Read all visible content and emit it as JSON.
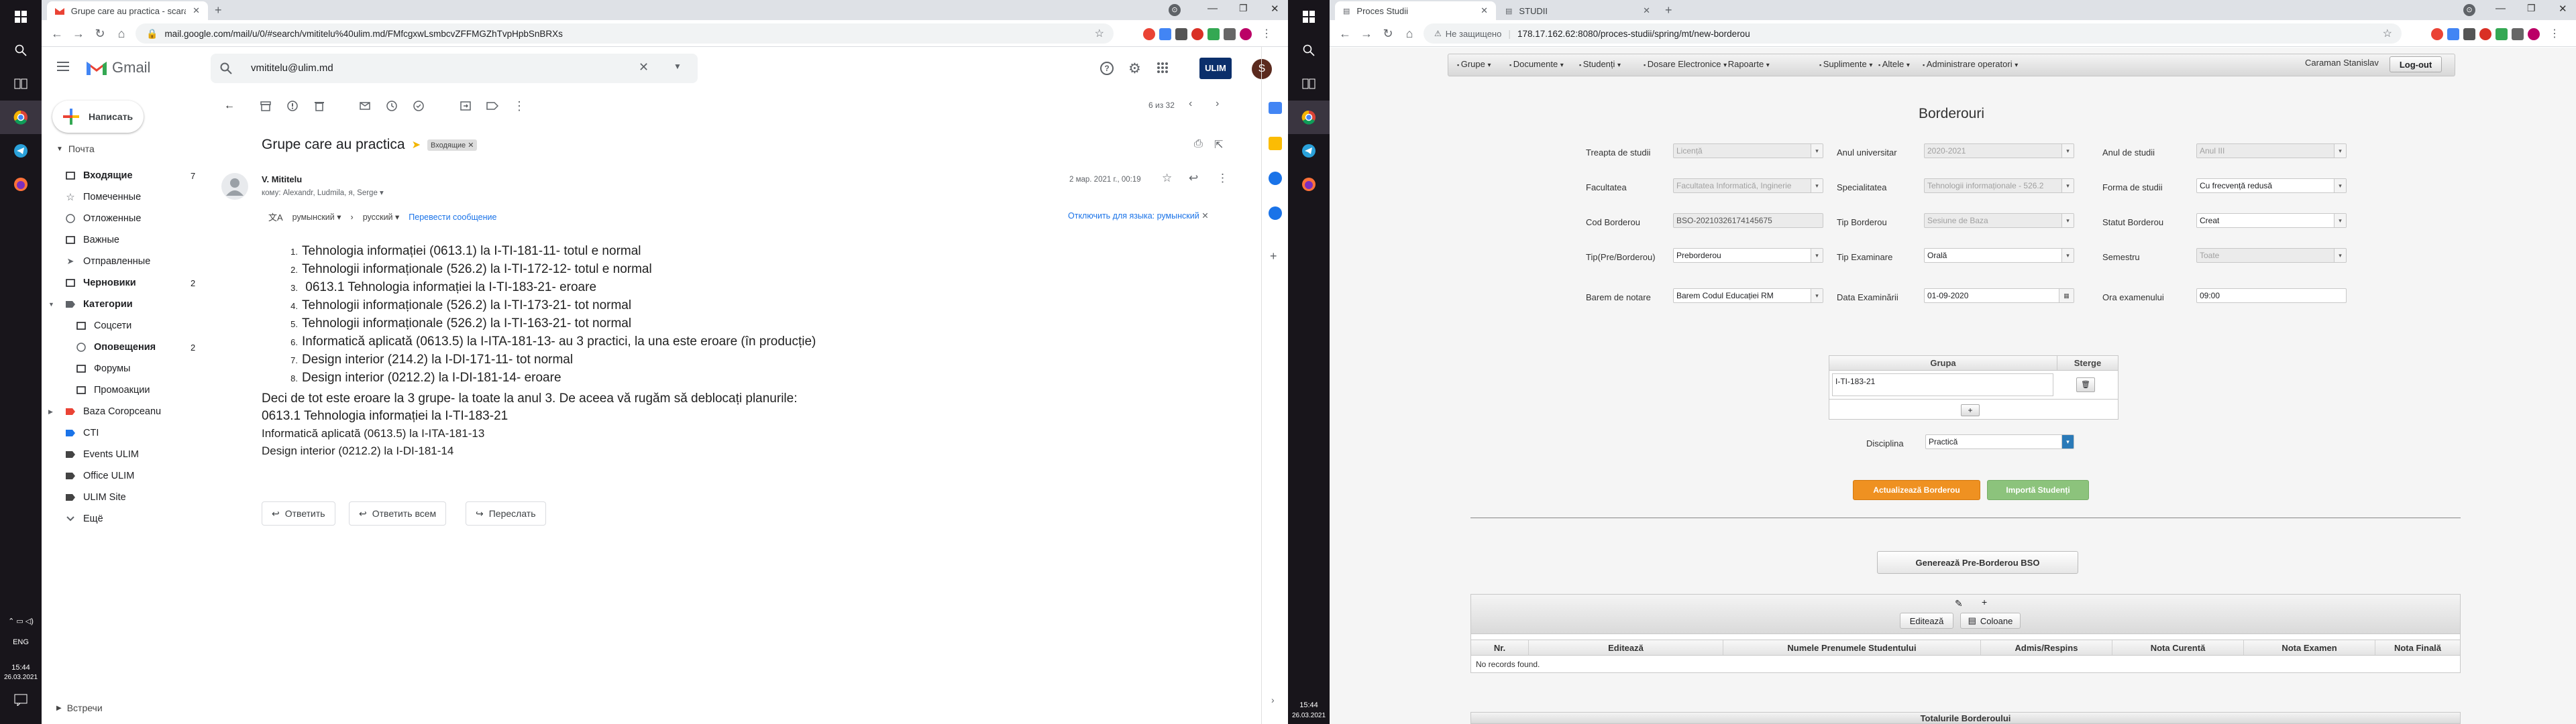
{
  "taskbar_left": {
    "time": "15:44",
    "date": "26.03.2021",
    "lang": "ENG"
  },
  "taskbar_right": {
    "time": "15:44",
    "date": "26.03.2021"
  },
  "win1": {
    "tab_title": "Grupe care au practica - scaram",
    "url": "mail.google.com/mail/u/0/#search/vmititelu%40ulim.md/FMfcgxwLsmbcvZFFMGZhTvpHpbSnBRXs",
    "product": "Gmail",
    "search": "vmititelu@ulim.md",
    "compose": "Написать",
    "avatar": "S",
    "brand_logo": "ULIM",
    "mail_section": "Почта",
    "folders": [
      {
        "label": "Входящие",
        "count": "7",
        "bold": true
      },
      {
        "label": "Помеченные",
        "count": ""
      },
      {
        "label": "Отложенные",
        "count": ""
      },
      {
        "label": "Важные",
        "count": ""
      },
      {
        "label": "Отправленные",
        "count": ""
      },
      {
        "label": "Черновики",
        "count": "2",
        "bold": true
      },
      {
        "label": "Категории",
        "count": "",
        "bold": true
      },
      {
        "label": "Соцсети",
        "count": ""
      },
      {
        "label": "Оповещения",
        "count": "2",
        "bold": true
      },
      {
        "label": "Форумы",
        "count": ""
      },
      {
        "label": "Промоакции",
        "count": ""
      },
      {
        "label": "Baza Coropceanu",
        "count": ""
      },
      {
        "label": "CTI",
        "count": ""
      },
      {
        "label": "Events ULIM",
        "count": ""
      },
      {
        "label": "Office ULIM",
        "count": ""
      },
      {
        "label": "ULIM Site",
        "count": ""
      },
      {
        "label": "Ещё",
        "count": ""
      }
    ],
    "meet": "Встречи",
    "pager": "6 из 32",
    "subject": "Grupe care au practica",
    "label_chip": "Входящие",
    "sender": "V. Mititelu",
    "recipients": "кому: Alexandr, Ludmila, я, Serge",
    "date": "2 мар. 2021 г., 00:19",
    "translate": {
      "from": "румынский",
      "to": "русский",
      "action": "Перевести сообщение",
      "disable": "Отключить для языка: румынский"
    },
    "list": [
      "Tehnologia informației (0613.1) la I-TI-181-11- totul e normal",
      "Tehnologii informaționale (526.2) la I-TI-172-12- totul e normal",
      " 0613.1 Tehnologia informației la I-TI-183-21- eroare",
      "Tehnologii informaționale (526.2) la I-TI-173-21- tot normal",
      "Tehnologii informaționale (526.2) la I-TI-163-21- tot normal",
      "Informatică aplicată (0613.5) la I-ITA-181-13- au 3 practici, la una este eroare (în producție)",
      "Design interior (214.2) la I-DI-171-11- tot normal",
      "Design interior (0212.2) la I-DI-181-14- eroare"
    ],
    "para1": "Deci de tot este eroare la 3 grupe- la toate la anul 3. De aceea vă rugăm să deblocați planurile:",
    "para2": "0613.1 Tehnologia informației la I-TI-183-21",
    "para3": "Informatică aplicată (0613.5) la I-ITA-181-13",
    "para4": "Design interior (0212.2) la I-DI-181-14",
    "reply": "Ответить",
    "reply_all": "Ответить всем",
    "forward": "Переслать"
  },
  "win2": {
    "tab1": "Proces Studii",
    "tab2": "STUDII",
    "insecure": "Не защищено",
    "url": "178.17.162.62:8080/proces-studii/spring/mt/new-borderou",
    "menu": [
      "Grupe",
      "Documente",
      "Studenți",
      "Dosare Electronice",
      "Rapoarte",
      "Suplimente",
      "Altele",
      "Administrare operatori"
    ],
    "user": "Caraman Stanislav",
    "logout": "Log-out",
    "heading": "Borderouri",
    "f": {
      "treapta_l": "Treapta de studii",
      "treapta_v": "Licență",
      "anuniv_l": "Anul universitar",
      "anuniv_v": "2020-2021",
      "anstud_l": "Anul de studii",
      "anstud_v": "Anul III",
      "fac_l": "Facultatea",
      "fac_v": "Facultatea Informatică, Inginerie",
      "spec_l": "Specialitatea",
      "spec_v": "Tehnologii informaționale - 526.2",
      "forma_l": "Forma de studii",
      "forma_v": "Cu frecvență redusă",
      "cod_l": "Cod Borderou",
      "cod_v": "BSO-20210326174145675",
      "tipb_l": "Tip Borderou",
      "tipb_v": "Sesiune de Baza",
      "statut_l": "Statut Borderou",
      "statut_v": "Creat",
      "tippre_l": "Tip(Pre/Borderou)",
      "tippre_v": "Preborderou",
      "tipex_l": "Tip Examinare",
      "tipex_v": "Orală",
      "sem_l": "Semestru",
      "sem_v": "Toate",
      "barem_l": "Barem de notare",
      "barem_v": "Barem Codul Educației RM",
      "data_l": "Data Examinării",
      "data_v": "01-09-2020",
      "ora_l": "Ora examenului",
      "ora_v": "09:00"
    },
    "grupa_h": "Grupa",
    "sterge_h": "Sterge",
    "grupa_v": "I-TI-183-21",
    "disc_l": "Disciplina",
    "disc_v": "Practică",
    "btn_update": "Actualizează Borderou",
    "btn_import": "Importă Studenți",
    "btn_gen": "Generează Pre-Borderou BSO",
    "btn_edit": "Editează",
    "btn_cols": "Coloane",
    "cols": [
      "Nr.",
      "Editează",
      "Numele Prenumele Studentului",
      "Admis/Respins",
      "Nota Curentă",
      "Nota Examen",
      "Nota Finală"
    ],
    "empty": "No records found.",
    "totals": "Totalurile Borderoului"
  },
  "colors": {
    "taskbar": "#18151b",
    "gmail_red": "#ea4335",
    "update": "#ef9121",
    "import": "#8cc37c"
  }
}
